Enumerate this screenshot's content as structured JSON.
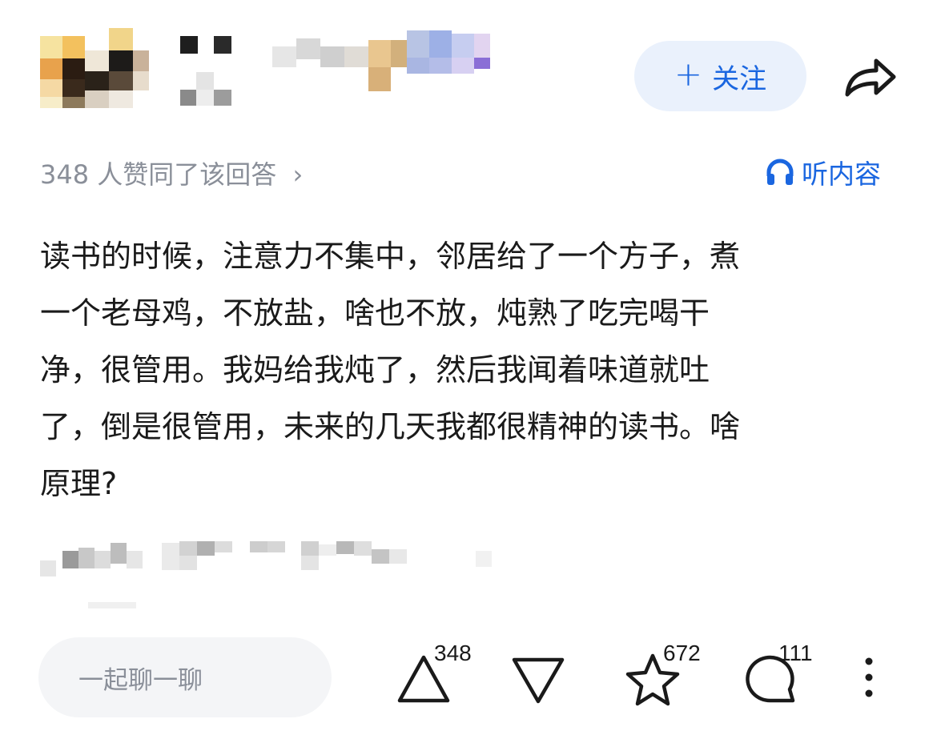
{
  "header": {
    "follow_label": "关注",
    "follow_icon": "plus-icon",
    "share_icon": "share-arrow-icon"
  },
  "meta": {
    "likes_text": "348 人赞同了该回答",
    "likes_chevron": "›",
    "listen_label": "听内容",
    "listen_icon": "headphones-icon"
  },
  "answer": {
    "line1": "读书的时候，注意力不集中，邻居给了一个方子，煮",
    "line2": "一个老母鸡，不放盐，啥也不放，炖熟了吃完喝干",
    "line3": "净，很管用。我妈给我炖了，然后我闻着味道就吐",
    "line4": "了，倒是很管用，未来的几天我都很精神的读书。啥",
    "line5": "原理?"
  },
  "bottom_bar": {
    "chat_placeholder": "一起聊一聊",
    "upvote_count": "348",
    "favorite_count": "672",
    "comment_count": "111"
  },
  "colors": {
    "accent": "#1a66e0",
    "follow_bg": "#eaf1fc",
    "muted_text": "#8a8f99",
    "body_text": "#1a1a1a",
    "input_bg": "#f4f5f7"
  }
}
